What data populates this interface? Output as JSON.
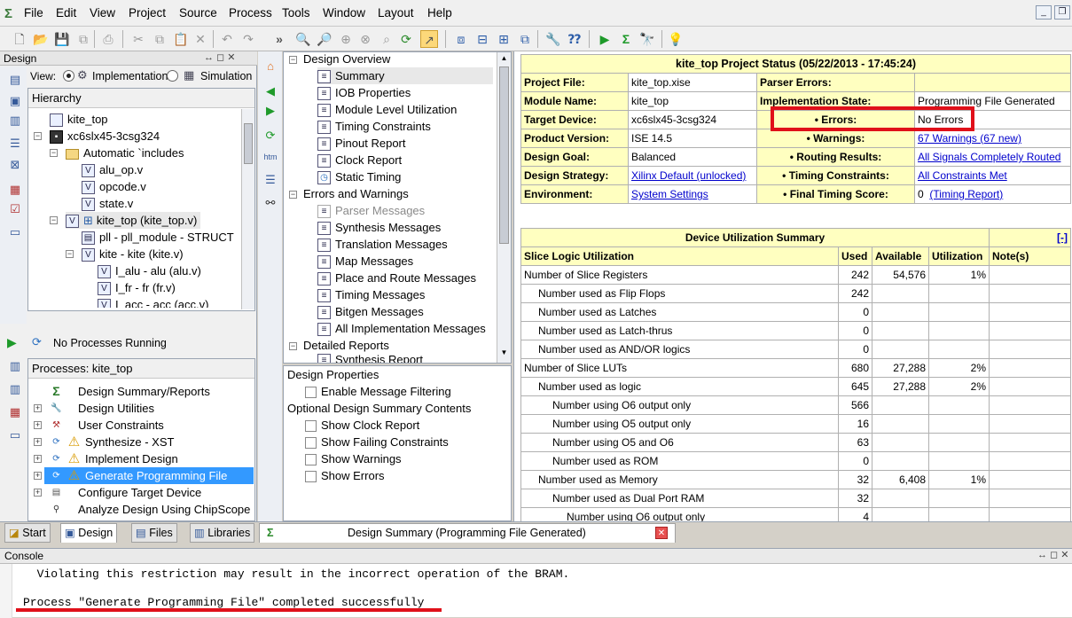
{
  "menu": [
    "File",
    "Edit",
    "View",
    "Project",
    "Source",
    "Process",
    "Tools",
    "Window",
    "Layout",
    "Help"
  ],
  "design_panel": {
    "title": "Design",
    "view_label": "View:",
    "view_options": [
      "Implementation",
      "Simulation"
    ],
    "hierarchy_title": "Hierarchy",
    "hierarchy": [
      {
        "label": "kite_top",
        "icon": "file-icon",
        "depth": 0
      },
      {
        "label": "xc6slx45-3csg324",
        "icon": "chip-icon",
        "depth": 0
      },
      {
        "label": "Automatic `includes",
        "icon": "folder-icon",
        "depth": 1
      },
      {
        "label": "alu_op.v",
        "icon": "verilog-icon",
        "depth": 2
      },
      {
        "label": "opcode.v",
        "icon": "verilog-icon",
        "depth": 2
      },
      {
        "label": "state.v",
        "icon": "verilog-icon",
        "depth": 2
      },
      {
        "label": "kite_top (kite_top.v)",
        "icon": "verilog-icon",
        "depth": 1
      },
      {
        "label": "pll - pll_module - STRUCT",
        "icon": "verilog-icon",
        "depth": 2
      },
      {
        "label": "kite - kite (kite.v)",
        "icon": "verilog-icon",
        "depth": 2
      },
      {
        "label": "I_alu - alu (alu.v)",
        "icon": "verilog-icon",
        "depth": 3
      },
      {
        "label": "I_fr - fr (fr.v)",
        "icon": "verilog-icon",
        "depth": 3
      },
      {
        "label": "I_acc - acc (acc.v)",
        "icon": "verilog-icon",
        "depth": 3
      }
    ],
    "status": "No Processes Running",
    "processes_title": "Processes: kite_top",
    "processes": [
      "Design Summary/Reports",
      "Design Utilities",
      "User Constraints",
      "Synthesize - XST",
      "Implement Design",
      "Generate Programming File",
      "Configure Target Device",
      "Analyze Design Using ChipScope"
    ]
  },
  "nav_panel": {
    "sections": {
      "overview": "Design Overview",
      "errors": "Errors and Warnings",
      "detailed": "Detailed Reports"
    },
    "overview_items": [
      "Summary",
      "IOB Properties",
      "Module Level Utilization",
      "Timing Constraints",
      "Pinout Report",
      "Clock Report",
      "Static Timing"
    ],
    "message_items": [
      "Parser Messages",
      "Synthesis Messages",
      "Translation Messages",
      "Map Messages",
      "Place and Route Messages",
      "Timing Messages",
      "Bitgen Messages",
      "All Implementation Messages"
    ],
    "detailed_items": [
      "Synthesis Report"
    ],
    "design_properties": "Design Properties",
    "enable_filtering": "Enable Message Filtering",
    "optional_title": "Optional Design Summary Contents",
    "optional_items": [
      "Show Clock Report",
      "Show Failing Constraints",
      "Show Warnings",
      "Show Errors"
    ]
  },
  "status_table": {
    "header": "kite_top Project Status (05/22/2013 - 17:45:24)",
    "rows": [
      {
        "l1": "Project File:",
        "v1": "kite_top.xise",
        "l2": "Parser Errors:",
        "v2": ""
      },
      {
        "l1": "Module Name:",
        "v1": "kite_top",
        "l2": "Implementation State:",
        "v2": "Programming File Generated"
      },
      {
        "l1": "Target Device:",
        "v1": "xc6slx45-3csg324",
        "l2": "• Errors:",
        "v2": "No Errors"
      },
      {
        "l1": "Product Version:",
        "v1": "ISE 14.5",
        "l2": "• Warnings:",
        "v2": "67 Warnings (67 new)"
      },
      {
        "l1": "Design Goal:",
        "v1": "Balanced",
        "l2": "• Routing Results:",
        "v2": "All Signals Completely Routed"
      },
      {
        "l1": "Design Strategy:",
        "v1": "Xilinx Default (unlocked)",
        "l2": "• Timing Constraints:",
        "v2": "All Constraints Met"
      },
      {
        "l1": "Environment:",
        "v1": "System Settings",
        "l2": "• Final Timing Score:",
        "v2": "0"
      }
    ],
    "timing_report_link": "(Timing Report)"
  },
  "utilization": {
    "header": "Device Utilization Summary",
    "collapse": "[-]",
    "columns": [
      "Slice Logic Utilization",
      "Used",
      "Available",
      "Utilization",
      "Note(s)"
    ],
    "rows": [
      {
        "name": "Number of Slice Registers",
        "indent": 0,
        "used": "242",
        "avail": "54,576",
        "util": "1%"
      },
      {
        "name": "Number used as Flip Flops",
        "indent": 1,
        "used": "242",
        "avail": "",
        "util": ""
      },
      {
        "name": "Number used as Latches",
        "indent": 1,
        "used": "0",
        "avail": "",
        "util": ""
      },
      {
        "name": "Number used as Latch-thrus",
        "indent": 1,
        "used": "0",
        "avail": "",
        "util": ""
      },
      {
        "name": "Number used as AND/OR logics",
        "indent": 1,
        "used": "0",
        "avail": "",
        "util": ""
      },
      {
        "name": "Number of Slice LUTs",
        "indent": 0,
        "used": "680",
        "avail": "27,288",
        "util": "2%"
      },
      {
        "name": "Number used as logic",
        "indent": 1,
        "used": "645",
        "avail": "27,288",
        "util": "2%"
      },
      {
        "name": "Number using O6 output only",
        "indent": 2,
        "used": "566",
        "avail": "",
        "util": ""
      },
      {
        "name": "Number using O5 output only",
        "indent": 2,
        "used": "16",
        "avail": "",
        "util": ""
      },
      {
        "name": "Number using O5 and O6",
        "indent": 2,
        "used": "63",
        "avail": "",
        "util": ""
      },
      {
        "name": "Number used as ROM",
        "indent": 2,
        "used": "0",
        "avail": "",
        "util": ""
      },
      {
        "name": "Number used as Memory",
        "indent": 1,
        "used": "32",
        "avail": "6,408",
        "util": "1%"
      },
      {
        "name": "Number used as Dual Port RAM",
        "indent": 2,
        "used": "32",
        "avail": "",
        "util": ""
      },
      {
        "name": "Number using O6 output only",
        "indent": 3,
        "used": "4",
        "avail": "",
        "util": ""
      }
    ]
  },
  "tabs": [
    "Start",
    "Design",
    "Files",
    "Libraries"
  ],
  "doc_tab": "Design Summary (Programming File Generated)",
  "console": {
    "title": "Console",
    "lines": [
      "  Violating this restriction may result in the incorrect operation of the BRAM.",
      "",
      "Process \"Generate Programming File\" completed successfully"
    ]
  },
  "colors": {
    "highlight_red": "#e0101a",
    "selection": "#3399ff",
    "yellow_cell": "#ffffc0"
  }
}
